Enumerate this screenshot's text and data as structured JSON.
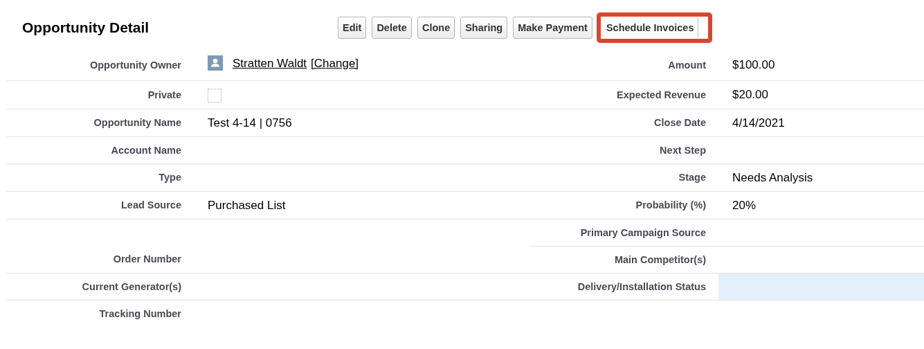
{
  "title": "Opportunity Detail",
  "buttons": [
    {
      "label": "Edit",
      "highlighted": false
    },
    {
      "label": "Delete",
      "highlighted": false
    },
    {
      "label": "Clone",
      "highlighted": false
    },
    {
      "label": "Sharing",
      "highlighted": false
    },
    {
      "label": "Make Payment",
      "highlighted": false
    },
    {
      "label": "Schedule Invoices",
      "highlighted": true
    }
  ],
  "rows": [
    {
      "left": {
        "label": "Opportunity Owner",
        "kind": "user",
        "name": "Stratten Waldt",
        "change": "[Change]"
      },
      "right": {
        "label": "Amount",
        "kind": "text",
        "value": "$100.00"
      }
    },
    {
      "left": {
        "label": "Private",
        "kind": "checkbox",
        "checked": false
      },
      "right": {
        "label": "Expected Revenue",
        "kind": "text",
        "value": "$20.00"
      }
    },
    {
      "left": {
        "label": "Opportunity Name",
        "kind": "text",
        "value": "Test 4-14 | 0756"
      },
      "right": {
        "label": "Close Date",
        "kind": "text",
        "value": "4/14/2021"
      }
    },
    {
      "left": {
        "label": "Account Name",
        "kind": "text"
      },
      "right": {
        "label": "Next Step",
        "kind": "text"
      }
    },
    {
      "left": {
        "label": "Type",
        "kind": "text"
      },
      "right": {
        "label": "Stage",
        "kind": "text",
        "value": "Needs Analysis"
      }
    },
    {
      "left": {
        "label": "Lead Source",
        "kind": "text",
        "value": "Purchased List"
      },
      "right": {
        "label": "Probability (%)",
        "kind": "text",
        "value": "20%"
      }
    },
    {
      "right": {
        "label": "Primary Campaign Source",
        "kind": "text"
      }
    },
    {
      "left": {
        "label": "Order Number",
        "kind": "text"
      },
      "right": {
        "label": "Main Competitor(s)",
        "kind": "text"
      }
    },
    {
      "left": {
        "label": "Current Generator(s)",
        "kind": "text"
      },
      "right": {
        "label": "Delivery/Installation Status",
        "kind": "text",
        "highlighted": true
      }
    },
    {
      "left": {
        "label": "Tracking Number",
        "kind": "text"
      }
    }
  ]
}
